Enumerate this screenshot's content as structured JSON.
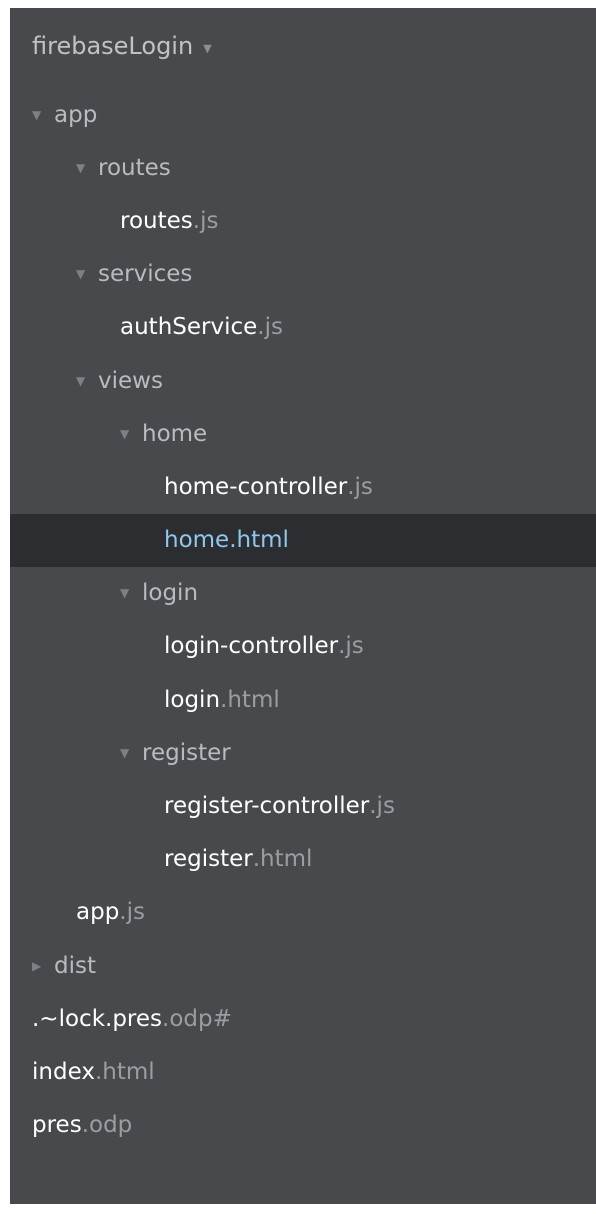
{
  "project": {
    "name": "firebaseLogin"
  },
  "tree": [
    {
      "kind": "folder",
      "depth": 0,
      "expanded": true,
      "name": "app"
    },
    {
      "kind": "folder",
      "depth": 1,
      "expanded": true,
      "name": "routes"
    },
    {
      "kind": "file",
      "depth": 2,
      "base": "routes",
      "ext": ".js"
    },
    {
      "kind": "folder",
      "depth": 1,
      "expanded": true,
      "name": "services"
    },
    {
      "kind": "file",
      "depth": 2,
      "base": "authService",
      "ext": ".js"
    },
    {
      "kind": "folder",
      "depth": 1,
      "expanded": true,
      "name": "views"
    },
    {
      "kind": "folder",
      "depth": 2,
      "expanded": true,
      "name": "home"
    },
    {
      "kind": "file",
      "depth": 3,
      "base": "home-controller",
      "ext": ".js"
    },
    {
      "kind": "file",
      "depth": 3,
      "base": "home",
      "ext": ".html",
      "selected": true
    },
    {
      "kind": "folder",
      "depth": 2,
      "expanded": true,
      "name": "login"
    },
    {
      "kind": "file",
      "depth": 3,
      "base": "login-controller",
      "ext": ".js"
    },
    {
      "kind": "file",
      "depth": 3,
      "base": "login",
      "ext": ".html"
    },
    {
      "kind": "folder",
      "depth": 2,
      "expanded": true,
      "name": "register"
    },
    {
      "kind": "file",
      "depth": 3,
      "base": "register-controller",
      "ext": ".js"
    },
    {
      "kind": "file",
      "depth": 3,
      "base": "register",
      "ext": ".html"
    },
    {
      "kind": "file",
      "depth": 1,
      "base": "app",
      "ext": ".js"
    },
    {
      "kind": "folder",
      "depth": 0,
      "expanded": false,
      "name": "dist"
    },
    {
      "kind": "file",
      "depth": 0,
      "base": ".~lock.pres",
      "ext": ".odp#"
    },
    {
      "kind": "file",
      "depth": 0,
      "base": "index",
      "ext": ".html"
    },
    {
      "kind": "file",
      "depth": 0,
      "base": "pres",
      "ext": ".odp"
    }
  ],
  "colors": {
    "panel_bg": "#47494d",
    "selected_bg": "#2c2d30",
    "selected_text": "#8ec8ec",
    "file_text": "#ffffff",
    "folder_text": "#b8bbc0",
    "extension_text": "#9a9da2"
  }
}
